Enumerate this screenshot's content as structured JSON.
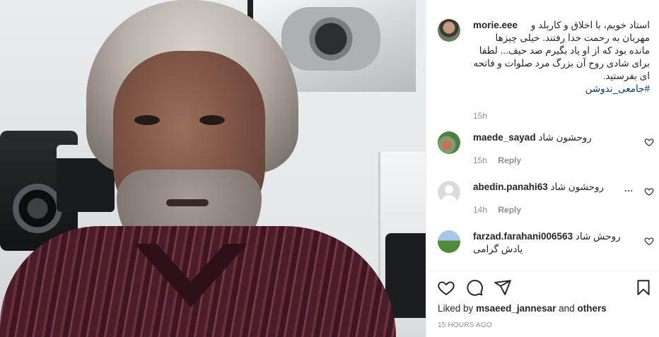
{
  "post": {
    "caption": {
      "username": "morie.eee",
      "text": "استاد خوبم، با اخلاق و کاربلد و مهربان به رحمت خدا رفتند. خیلی چیزها مانده بود که از او یاد بگیرم صد حیف... لطفا برای شادی روح آن بزرگ مرد صلوات و فاتحه ای بفرستید.",
      "hashtag": "#جامعی_ندوشن",
      "time": "15h"
    },
    "comments": [
      {
        "username": "maede_sayad",
        "text": "روحشون شاد",
        "time": "15h",
        "reply": "Reply"
      },
      {
        "username": "abedin.panahi63",
        "text": "روحشون شاد",
        "time": "14h",
        "reply": "Reply",
        "more": "..."
      },
      {
        "username": "farzad.farahani006563",
        "text": "روحش شاد یادش گرامی"
      }
    ]
  },
  "actions": {
    "liked_prefix": "Liked by",
    "liked_user": "msaeed_jannesar",
    "liked_and": "and",
    "liked_others": "others",
    "posted_ago": "15 HOURS AGO"
  },
  "icons": [
    "heart-icon",
    "comment-icon",
    "share-icon",
    "bookmark-icon"
  ]
}
